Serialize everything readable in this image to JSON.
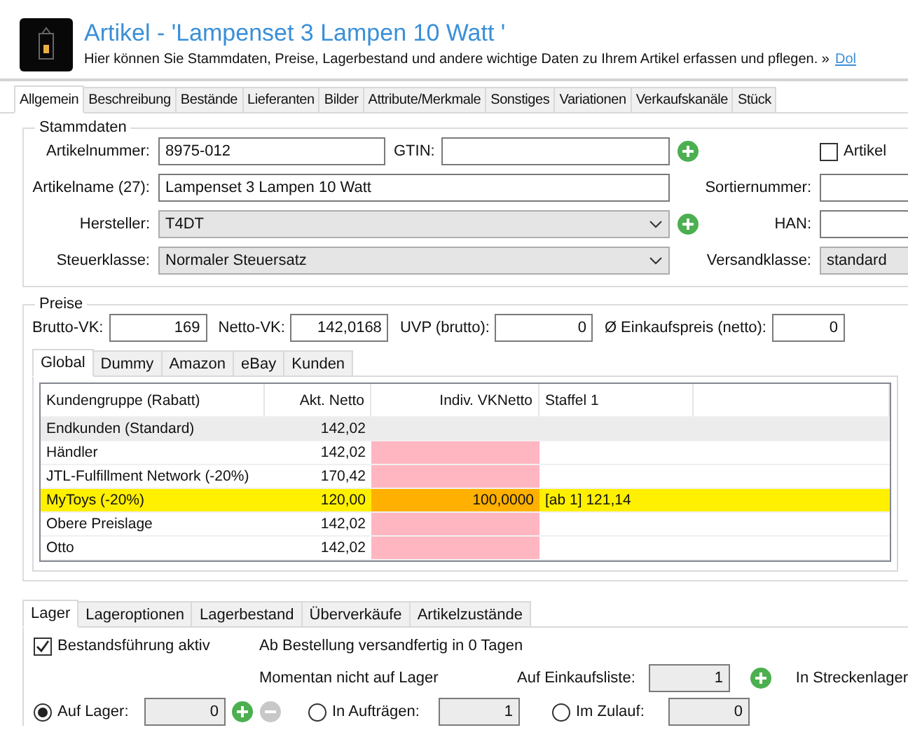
{
  "header": {
    "title": "Artikel - 'Lampenset 3 Lampen 10 Watt '",
    "subtitle": "Hier können Sie Stammdaten, Preise, Lagerbestand und andere wichtige Daten zu Ihrem Artikel erfassen und pflegen. »",
    "link": "Dol"
  },
  "tabs": [
    {
      "label": "Allgemein",
      "selected": true
    },
    {
      "label": "Beschreibung",
      "selected": false
    },
    {
      "label": "Bestände",
      "selected": false
    },
    {
      "label": "Lieferanten",
      "selected": false
    },
    {
      "label": "Bilder",
      "selected": false
    },
    {
      "label": "Attribute/Merkmale",
      "selected": false
    },
    {
      "label": "Sonstiges",
      "selected": false
    },
    {
      "label": "Variationen",
      "selected": false
    },
    {
      "label": "Verkaufskanäle",
      "selected": false
    },
    {
      "label": "Stück",
      "selected": false
    }
  ],
  "master_data": {
    "title": "Stammdaten",
    "article_number": {
      "label": "Artikelnummer:",
      "value": "8975-012"
    },
    "gtin": {
      "label": "GTIN:"
    },
    "article_flag": {
      "label": "Artikel",
      "checked": false
    },
    "article_name": {
      "label": "Artikelname (27):",
      "value": "Lampenset 3 Lampen 10 Watt"
    },
    "sort_number": {
      "label": "Sortiernummer:"
    },
    "manufacturer": {
      "label": "Hersteller:",
      "value": "T4DT"
    },
    "han": {
      "label": "HAN:"
    },
    "tax_class": {
      "label": "Steuerklasse:",
      "value": "Normaler Steuersatz"
    },
    "shipping_class": {
      "label": "Versandklasse:",
      "value": "standard"
    }
  },
  "prices": {
    "title": "Preise",
    "fields": [
      {
        "label": "Brutto-VK:",
        "value": "169"
      },
      {
        "label": "Netto-VK:",
        "value": "142,0168"
      },
      {
        "label": "UVP (brutto):",
        "value": "0"
      },
      {
        "label": "Ø Einkaufspreis (netto):",
        "value": "0"
      }
    ],
    "tabs": [
      {
        "label": "Global",
        "selected": true
      },
      {
        "label": "Dummy",
        "selected": false
      },
      {
        "label": "Amazon",
        "selected": false
      },
      {
        "label": "eBay",
        "selected": false
      },
      {
        "label": "Kunden",
        "selected": false
      }
    ],
    "table": {
      "columns": [
        "Kundengruppe (Rabatt)",
        "Akt. Netto",
        "Indiv. VKNetto",
        "Staffel 1"
      ],
      "rows": [
        {
          "group": "Endkunden (Standard)",
          "net": "142,02",
          "selected": true,
          "highlighted": false,
          "marked": false
        },
        {
          "group": "Händler",
          "net": "142,02",
          "selected": false,
          "highlighted": false,
          "marked": true
        },
        {
          "group": "JTL-Fulfillment Network (-20%)",
          "net": "170,42",
          "selected": false,
          "highlighted": false,
          "marked": true
        },
        {
          "group": "MyToys (-20%)",
          "net": "120,00",
          "individual": "100,0000",
          "tier_1": "[ab 1] 121,14",
          "selected": false,
          "highlighted": true,
          "marked": false
        },
        {
          "group": "Obere Preislage",
          "net": "142,02",
          "selected": false,
          "highlighted": false,
          "marked": true
        },
        {
          "group": "Otto",
          "net": "142,02",
          "selected": false,
          "highlighted": false,
          "marked": true
        }
      ]
    }
  },
  "stock": {
    "tabs": [
      {
        "label": "Lager",
        "selected": true
      },
      {
        "label": "Lageroptionen",
        "selected": false
      },
      {
        "label": "Lagerbestand",
        "selected": false
      },
      {
        "label": "Überverkäufe",
        "selected": false
      },
      {
        "label": "Artikelzustände",
        "selected": false
      }
    ],
    "tracking": {
      "label": "Bestandsführung aktiv",
      "checked": true
    },
    "dispatch_note": "Ab Bestellung versandfertig in 0 Tagen",
    "status_note": "Momentan nicht auf Lager",
    "purchase_list": {
      "label": "Auf Einkaufsliste:",
      "value": "1"
    },
    "drop_shipping": "In Streckenlager",
    "quantities": [
      {
        "kind": "adjustable",
        "label": "Auf Lager:",
        "value": "0",
        "selected": true
      },
      {
        "kind": "plain",
        "label": "In Aufträgen:",
        "value": "1",
        "selected": false
      },
      {
        "kind": "plain",
        "label": "Im Zulauf:",
        "value": "0",
        "selected": false
      }
    ]
  }
}
